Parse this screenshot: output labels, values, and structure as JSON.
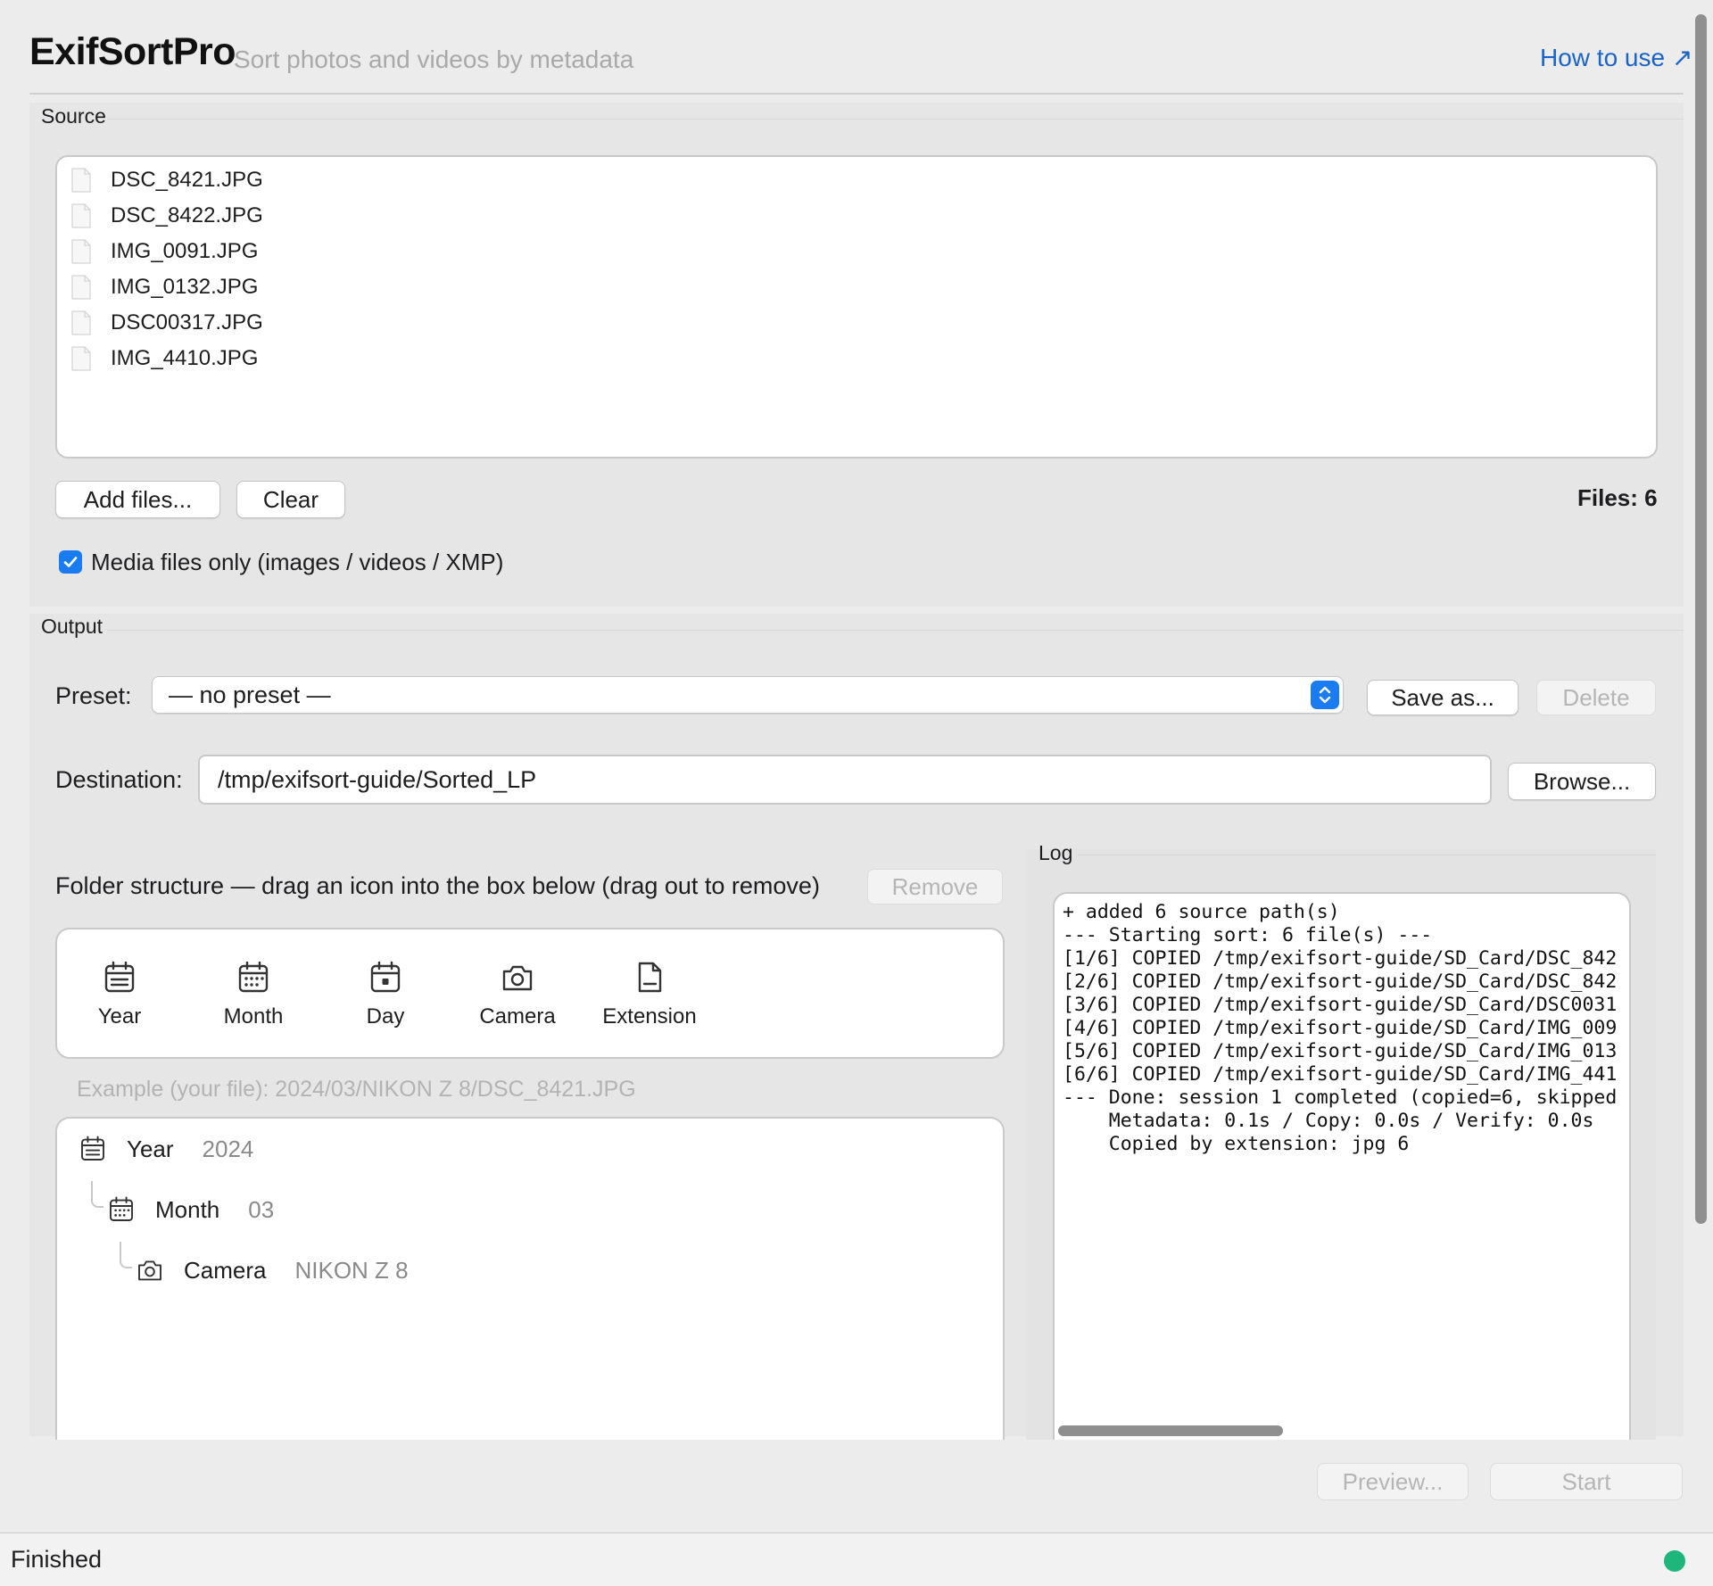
{
  "header": {
    "title": "ExifSortPro",
    "subtitle": "Sort photos and videos by metadata",
    "help_link": "How to use ↗"
  },
  "source": {
    "label": "Source",
    "files": [
      "DSC_8421.JPG",
      "DSC_8422.JPG",
      "IMG_0091.JPG",
      "IMG_0132.JPG",
      "DSC00317.JPG",
      "IMG_4410.JPG"
    ],
    "add_button": "Add files...",
    "clear_button": "Clear",
    "count_text": "Files: 6",
    "media_only_label": "Media files only (images / videos / XMP)",
    "media_only_checked": true
  },
  "output": {
    "label": "Output",
    "preset_label": "Preset:",
    "preset_value": "— no preset —",
    "save_as_button": "Save as...",
    "delete_button": "Delete",
    "destination_label": "Destination:",
    "destination_value": "/tmp/exifsort-guide/Sorted_LP",
    "browse_button": "Browse...",
    "folder_structure_label": "Folder structure — drag an icon into the box below (drag out to remove)",
    "remove_button": "Remove",
    "palette": [
      "Year",
      "Month",
      "Day",
      "Camera",
      "Extension"
    ],
    "example": "Example (your file): 2024/03/NIKON Z 8/DSC_8421.JPG",
    "tree": [
      {
        "name": "Year",
        "value": "2024",
        "icon": "calendar-icon"
      },
      {
        "name": "Month",
        "value": "03",
        "icon": "calendar-grid-icon"
      },
      {
        "name": "Camera",
        "value": "NIKON Z 8",
        "icon": "camera-icon"
      }
    ]
  },
  "log": {
    "label": "Log",
    "lines": [
      "+ added 6 source path(s)",
      "--- Starting sort: 6 file(s) ---",
      "[1/6] COPIED /tmp/exifsort-guide/SD_Card/DSC_842",
      "[2/6] COPIED /tmp/exifsort-guide/SD_Card/DSC_842",
      "[3/6] COPIED /tmp/exifsort-guide/SD_Card/DSC0031",
      "[4/6] COPIED /tmp/exifsort-guide/SD_Card/IMG_009",
      "[5/6] COPIED /tmp/exifsort-guide/SD_Card/IMG_013",
      "[6/6] COPIED /tmp/exifsort-guide/SD_Card/IMG_441",
      "--- Done: session 1 completed (copied=6, skipped",
      "    Metadata: 0.1s / Copy: 0.0s / Verify: 0.0s",
      "    Copied by extension: jpg 6"
    ]
  },
  "actions": {
    "preview_button": "Preview...",
    "start_button": "Start"
  },
  "status": {
    "text": "Finished",
    "indicator_color": "#1fb67c"
  },
  "colors": {
    "accent": "#1b7cf2",
    "link": "#1a64c8"
  }
}
